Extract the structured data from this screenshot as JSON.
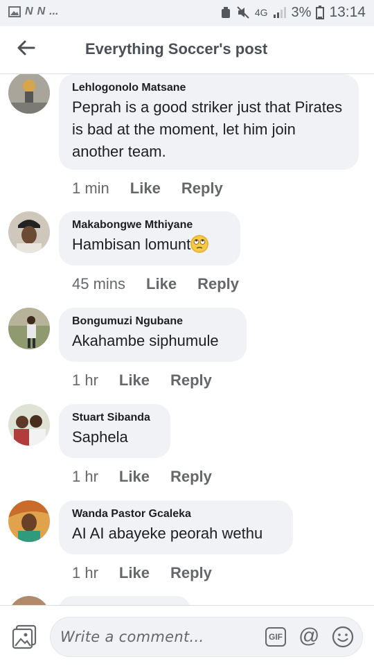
{
  "status_bar": {
    "left_icons": [
      "image-icon",
      "n-icon",
      "n-icon"
    ],
    "overflow": "...",
    "network": "4G",
    "battery_percent": "3%",
    "time": "13:14"
  },
  "header": {
    "title": "Everything Soccer's post"
  },
  "comments": [
    {
      "author": "Lehlogonolo Matsane",
      "text": "Peprah is a good striker just that Pirates is bad at the moment, let him join another team.",
      "time": "1 min",
      "like": "Like",
      "reply": "Reply"
    },
    {
      "author": "Makabongwe Mthiyane",
      "text": "Hambisan lomunt",
      "emoji": "rolling-eyes-emoji",
      "time": "45 mins",
      "like": "Like",
      "reply": "Reply"
    },
    {
      "author": "Bongumuzi Ngubane",
      "text": "Akahambe siphumule",
      "time": "1 hr",
      "like": "Like",
      "reply": "Reply"
    },
    {
      "author": "Stuart Sibanda",
      "text": "Saphela",
      "time": "1 hr",
      "like": "Like",
      "reply": "Reply"
    },
    {
      "author": "Wanda Pastor Gcaleka",
      "text": "AI AI abayeke peorah wethu",
      "time": "1 hr",
      "like": "Like",
      "reply": "Reply"
    }
  ],
  "composer": {
    "placeholder": "Write a comment...",
    "gif_label": "GIF",
    "at_label": "@"
  },
  "colors": {
    "bubble": "#f0f2f5",
    "meta_text": "#65676b",
    "title": "#4b4f56"
  }
}
